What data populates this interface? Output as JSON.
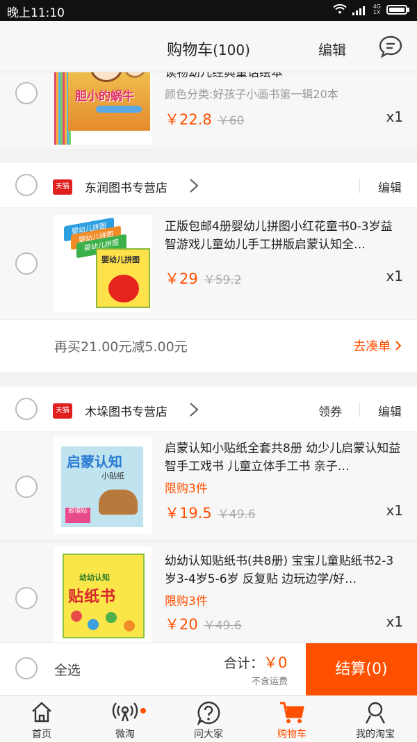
{
  "status_bar": {
    "time": "晚上11:10",
    "network": "4G\n1X"
  },
  "nav": {
    "title": "购物车",
    "count": "(100)",
    "edit": "编辑"
  },
  "items_top": [
    {
      "title": "读物幼儿经典童话绘本",
      "sku": "颜色分类:好孩子小画书第一辑20本",
      "price": "￥22.8",
      "original_price": "￥60",
      "qty": "x1",
      "cover_title": "胆小的蜗牛"
    }
  ],
  "stores": [
    {
      "name": "东润图书专营店",
      "edit": "编辑",
      "badge": "天猫",
      "items": [
        {
          "title": "正版包邮4册婴幼儿拼图小红花童书0-3岁益智游戏儿童幼儿手工拼版启蒙认知全…",
          "price": "￥29",
          "original_price": "￥59.2",
          "qty": "x1",
          "cover_title": "婴幼儿拼图"
        }
      ],
      "promo": {
        "text": "再买21.00元减5.00元",
        "link": "去凑单"
      }
    },
    {
      "name": "木垛图书专营店",
      "coupon": "领券",
      "edit": "编辑",
      "badge": "天猫",
      "items": [
        {
          "title": "启蒙认知小贴纸全套共8册 幼少儿启蒙认知益智手工戏书 儿童立体手工书 亲子…",
          "limit": "限购3件",
          "price": "￥19.5",
          "original_price": "￥49.6",
          "qty": "x1",
          "cover_title": "启蒙认知",
          "cover_sub": "小贴纸",
          "cover_tag": "超值贴"
        },
        {
          "title": "幼幼认知贴纸书(共8册) 宝宝儿童贴纸书2-3岁3-4岁5-6岁 反复贴 边玩边学/好…",
          "limit": "限购3件",
          "price": "￥20",
          "original_price": "￥49.6",
          "qty": "x1",
          "cover_title": "贴纸书",
          "cover_sub": "幼幼认知"
        }
      ]
    }
  ],
  "checkout": {
    "select_all": "全选",
    "total_label": "合计：",
    "total_value": "￥0",
    "shipping_note": "不含运费",
    "pay_button": "结算(0)"
  },
  "tabs": [
    {
      "label": "首页",
      "icon": "home-icon"
    },
    {
      "label": "微淘",
      "icon": "broadcast-icon"
    },
    {
      "label": "问大家",
      "icon": "question-icon"
    },
    {
      "label": "购物车",
      "icon": "cart-icon",
      "active": true
    },
    {
      "label": "我的淘宝",
      "icon": "profile-icon"
    }
  ],
  "colors": {
    "accent": "#ff5000",
    "tmall_red": "#e02020"
  }
}
